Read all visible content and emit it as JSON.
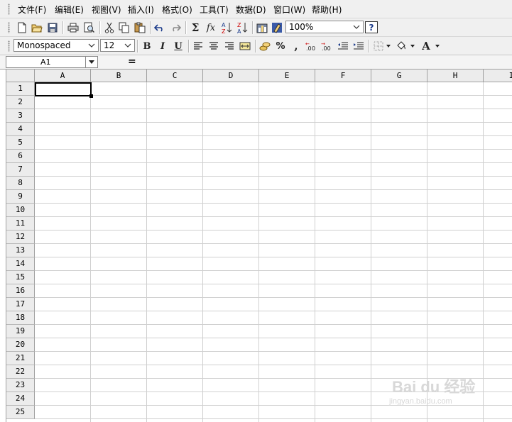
{
  "menubar": {
    "items": [
      "文件(F)",
      "编辑(E)",
      "视图(V)",
      "插入(I)",
      "格式(O)",
      "工具(T)",
      "数据(D)",
      "窗口(W)",
      "帮助(H)"
    ]
  },
  "toolbar": {
    "sum_label": "Σ",
    "function_label": "fx",
    "zoom_value": "100%",
    "help_label": "?"
  },
  "format_toolbar": {
    "font_name": "Monospaced",
    "font_size": "12",
    "bold_label": "B",
    "italic_label": "I",
    "underline_label": "U",
    "percent_label": "%",
    "comma_label": ",",
    "font_color_label": "A"
  },
  "formula_bar": {
    "cell_ref": "A1",
    "equals_label": "=",
    "formula_value": ""
  },
  "sheet": {
    "columns": [
      "A",
      "B",
      "C",
      "D",
      "E",
      "F",
      "G",
      "H",
      "I"
    ],
    "rows": [
      "1",
      "2",
      "3",
      "4",
      "5",
      "6",
      "7",
      "8",
      "9",
      "10",
      "11",
      "12",
      "13",
      "14",
      "15",
      "16",
      "17",
      "18",
      "19",
      "20",
      "21",
      "22",
      "23",
      "24",
      "25"
    ],
    "active_cell": "A1"
  },
  "watermark": {
    "brand": "Bai du 经验",
    "url": "jingyan.baidu.com"
  }
}
